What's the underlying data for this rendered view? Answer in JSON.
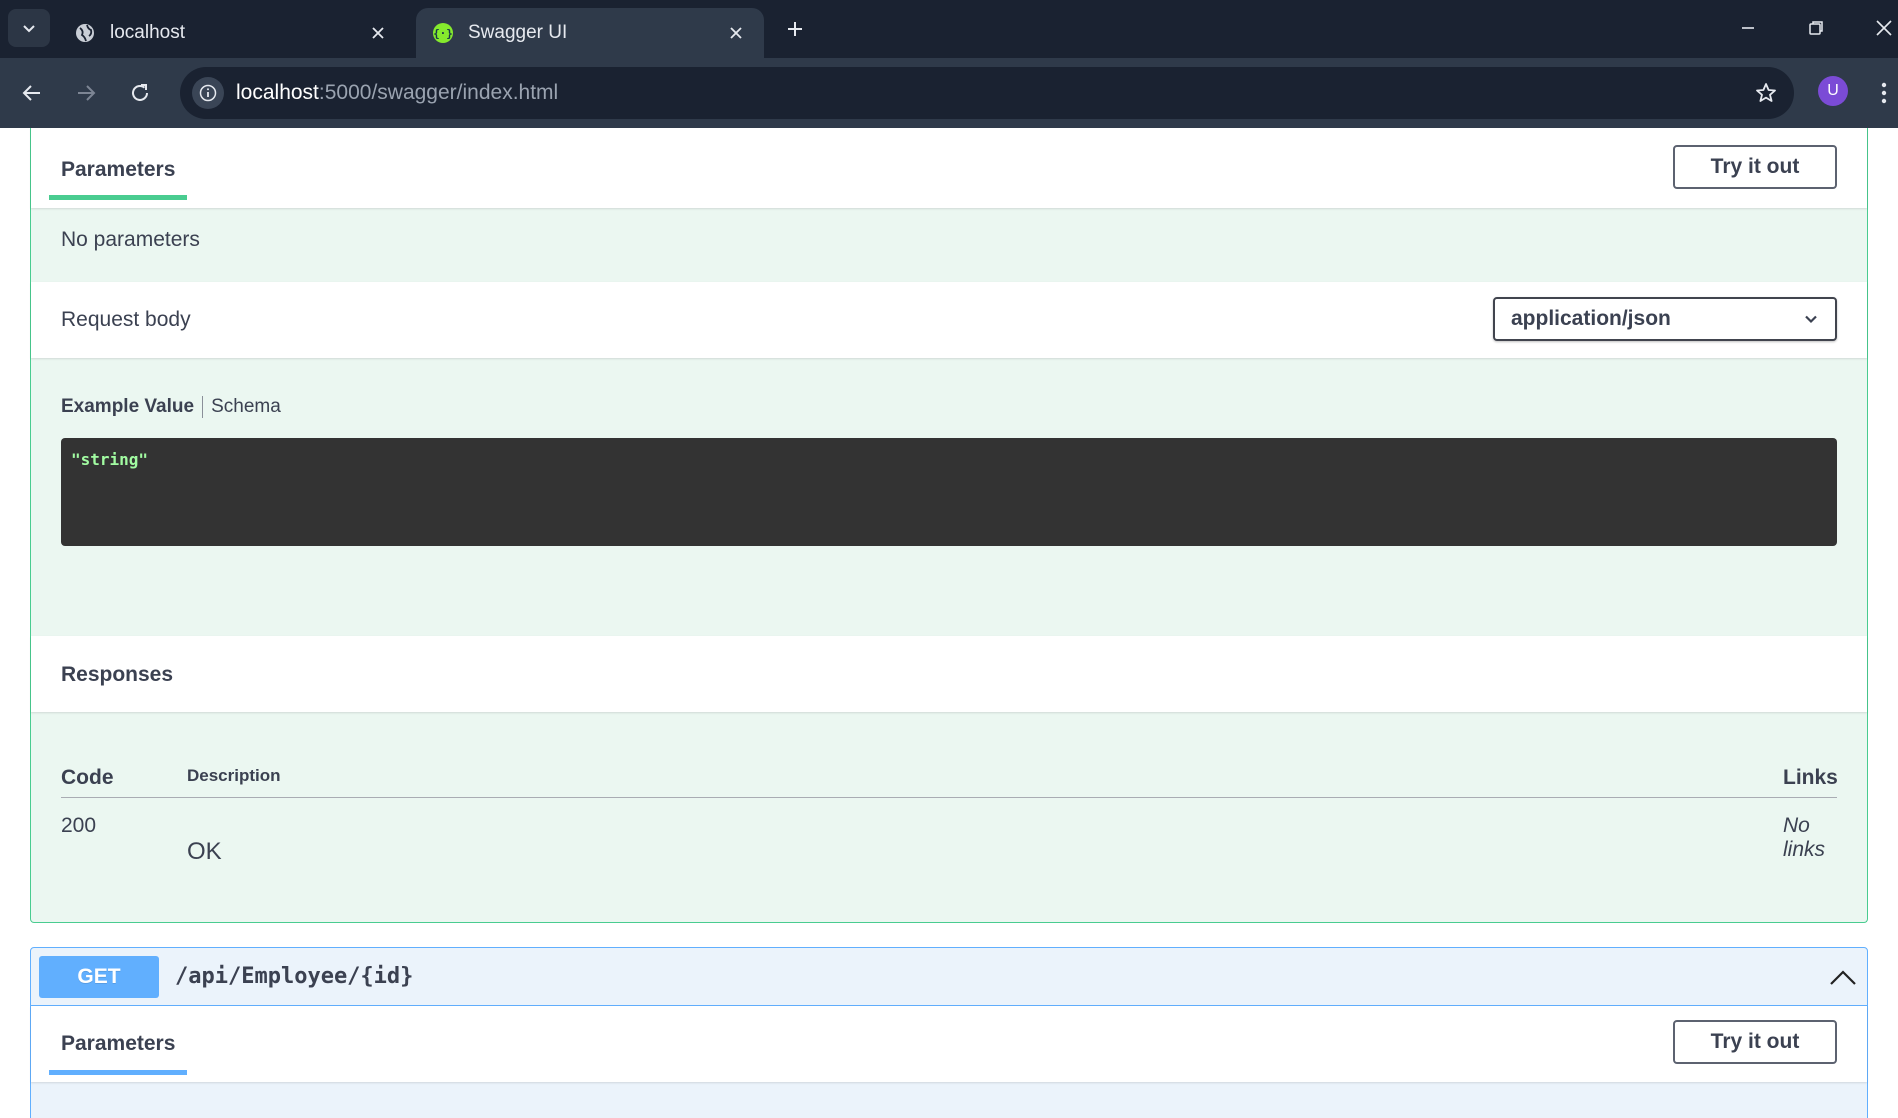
{
  "browser": {
    "tabs": [
      {
        "title": "localhost",
        "icon": "globe-icon",
        "active": false
      },
      {
        "title": "Swagger UI",
        "icon": "swagger-icon",
        "active": true
      }
    ],
    "url_host": "localhost",
    "url_rest": ":5000/swagger/index.html",
    "profile_initial": "U"
  },
  "post_block": {
    "parameters_tab": "Parameters",
    "try_it_out": "Try it out",
    "no_parameters": "No parameters",
    "request_body_label": "Request body",
    "content_type": "application/json",
    "example_value_tab": "Example Value",
    "schema_tab": "Schema",
    "example_code": "\"string\"",
    "responses_title": "Responses",
    "responses_headers": {
      "code": "Code",
      "description": "Description",
      "links": "Links"
    },
    "responses": [
      {
        "code": "200",
        "description": "OK",
        "links": "No links"
      }
    ]
  },
  "get_block": {
    "method": "GET",
    "path": "/api/Employee/{id}",
    "parameters_tab": "Parameters",
    "try_it_out": "Try it out"
  },
  "colors": {
    "post_accent": "#49cc90",
    "get_accent": "#61affe",
    "chrome_dark": "#1a2231",
    "chrome_toolbar": "#2f3a4a"
  }
}
